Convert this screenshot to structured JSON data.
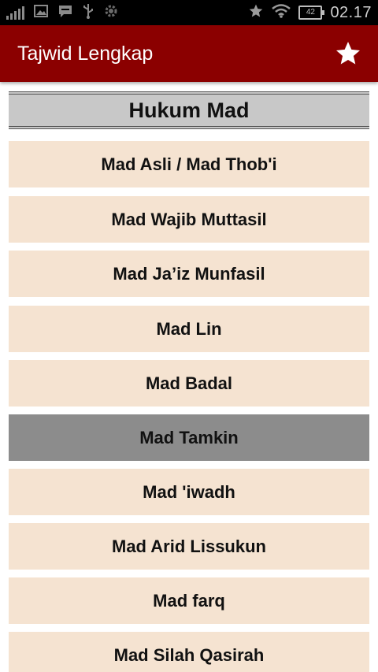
{
  "status_bar": {
    "time": "02.17",
    "battery": "42",
    "left_icons": [
      "signal-icon",
      "image-icon",
      "chat-icon",
      "usb-icon",
      "settings-icon"
    ],
    "right_icons": [
      "star-icon",
      "wifi-icon",
      "battery-icon"
    ]
  },
  "app_bar": {
    "title": "Tajwid Lengkap",
    "action_icon": "star-icon",
    "color": "#8b0000"
  },
  "section": {
    "title": "Hukum Mad"
  },
  "items": [
    {
      "label": "Mad Asli / Mad Thob'i",
      "selected": false
    },
    {
      "label": "Mad Wajib Muttasil",
      "selected": false
    },
    {
      "label": "Mad Ja’iz Munfasil",
      "selected": false
    },
    {
      "label": "Mad Lin",
      "selected": false
    },
    {
      "label": "Mad Badal",
      "selected": false
    },
    {
      "label": "Mad Tamkin",
      "selected": true
    },
    {
      "label": "Mad 'iwadh",
      "selected": false
    },
    {
      "label": "Mad Arid Lissukun",
      "selected": false
    },
    {
      "label": "Mad farq",
      "selected": false
    },
    {
      "label": "Mad Silah Qasirah",
      "selected": false
    }
  ],
  "colors": {
    "item_bg": "#f5e3d1",
    "item_selected_bg": "#8c8c8c",
    "header_bg": "#c8c8c8"
  }
}
